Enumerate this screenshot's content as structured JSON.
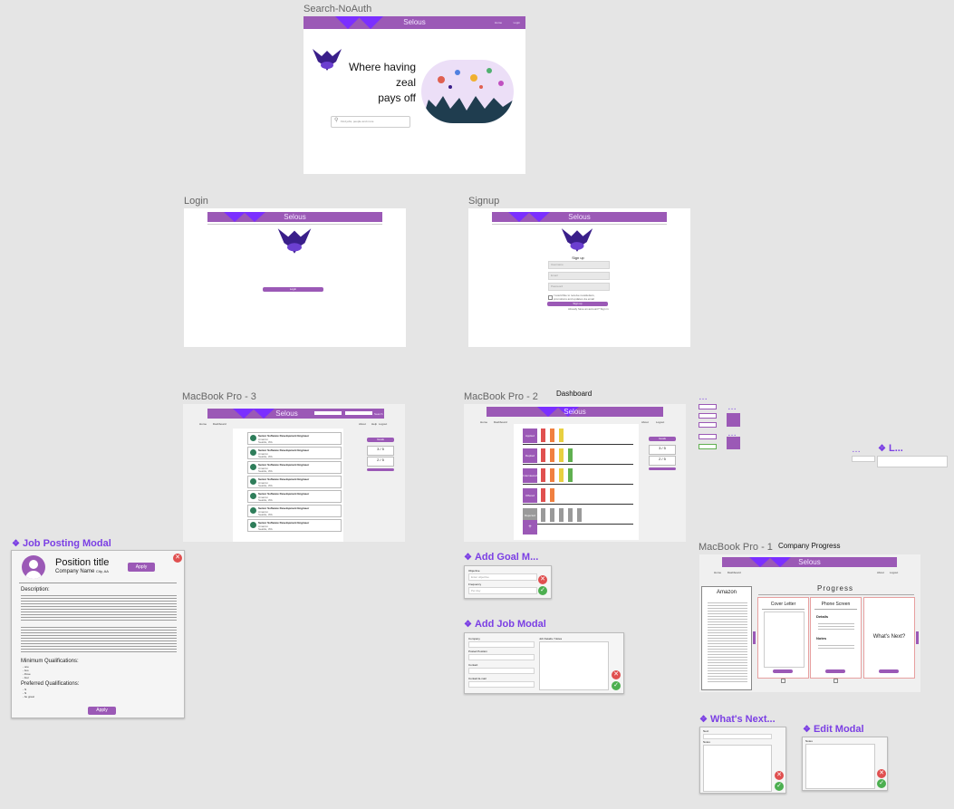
{
  "frames": {
    "search": {
      "label": "Search-NoAuth",
      "brand": "Selous",
      "nav_left": "Home",
      "nav_right": "Login",
      "tagline_1": "Where having",
      "tagline_2": "zeal",
      "tagline_3": "pays off",
      "search_placeholder": "Find jobs, people and more"
    },
    "login": {
      "label": "Login",
      "brand": "Selous",
      "login_button": "Login"
    },
    "signup": {
      "label": "Signup",
      "brand": "Selous",
      "heading": "Sign up",
      "field_1": "Username",
      "field_2": "Email",
      "field_3": "Password",
      "checkbox_text": "I would like to receive newsletters, promotions and updates via email",
      "signup_button": "Sign up",
      "footer_link": "Already have an account? Sign in"
    },
    "mbp3": {
      "label": "MacBook Pro - 3",
      "brand": "Selous",
      "nav_left_1": "Home",
      "nav_left_2": "Dashboard",
      "nav_right_1": "About",
      "nav_right_2": "Help",
      "nav_right_3": "Logout",
      "search_btn": "Search",
      "jobs": [
        {
          "title": "Senior Software Development Engineer",
          "company": "Amazon",
          "location": "Seattle, WA"
        },
        {
          "title": "Senior Software Development Engineer",
          "company": "Amazon",
          "location": "Seattle, WA"
        },
        {
          "title": "Senior Software Development Engineer",
          "company": "Amazon",
          "location": "Seattle, WA"
        },
        {
          "title": "Senior Software Development Engineer",
          "company": "Amazon",
          "location": "Seattle, WA"
        },
        {
          "title": "Senior Software Development Engineer",
          "company": "Amazon",
          "location": "Seattle, WA"
        },
        {
          "title": "Senior Software Development Engineer",
          "company": "Amazon",
          "location": "Seattle, WA"
        },
        {
          "title": "Senior Software Development Engineer",
          "company": "Amazon",
          "location": "Seattle, WA"
        }
      ],
      "goals_title": "Goals",
      "goal_1": "3 / 5",
      "goal_2": "2 / 5"
    },
    "mbp2": {
      "label": "MacBook Pro - 2",
      "annotation": "Dashboard",
      "brand": "Selous",
      "nav_left_1": "Home",
      "nav_left_2": "Dashboard",
      "nav_right_1": "About",
      "nav_right_2": "Logout",
      "rows": [
        {
          "name": "Applied",
          "bars": 3
        },
        {
          "name": "Replied",
          "bars": 4
        },
        {
          "name": "Interviewed",
          "bars": 4
        },
        {
          "name": "Offered",
          "bars": 2
        },
        {
          "name": "Rejected",
          "bars": 5
        }
      ],
      "add_label": "+",
      "goals_title": "Goals",
      "goal_1": "3 / 5",
      "goal_2": "2 / 5"
    },
    "mbp1": {
      "label": "MacBook Pro - 1",
      "annotation": "Company Progress",
      "brand": "Selous",
      "progress_title": "Progress",
      "company": "Amazon",
      "columns": [
        "Cover Letter",
        "Phone Screen",
        "What's Next?"
      ],
      "details_label": "Details",
      "notes_label": "Notes"
    }
  },
  "components": {
    "job_modal": {
      "label": "Job Posting Modal",
      "position_title": "Position title",
      "company_name": "Company Name",
      "location": "City, AA",
      "apply": "Apply",
      "description_label": "Description:",
      "min_qual_label": "Minimum Qualifications:",
      "pref_qual_label": "Preferred Qualifications:",
      "apply_bottom": "Apply",
      "min_quals": [
        "- one",
        "- two",
        "- three",
        "- four"
      ],
      "pref_quals": [
        "- hi",
        "- hi",
        "- be great"
      ]
    },
    "add_goal": {
      "label": "Add Goal M...",
      "field_1_label": "Objective",
      "field_1_placeholder": "Enter objective",
      "field_2_label": "Frequency",
      "field_2_placeholder": "Per day"
    },
    "add_job": {
      "label": "Add Job Modal",
      "company_label": "Company",
      "position_label": "Posted Position",
      "contact_label": "Contact",
      "email_label": "Contact E-mail",
      "details_label": "Job Details / Notes"
    },
    "whats_next": {
      "label": "What's Next...",
      "field_1_label": "Next",
      "field_2_label": "Notes"
    },
    "edit_modal": {
      "label": "Edit Modal",
      "field_label": "Notes"
    },
    "misc_l": {
      "label": "L..."
    }
  },
  "colors": {
    "brand": "#9b59b6",
    "notch": "#7b2fff",
    "eagle": "#3a1f8a",
    "danger": "#e05050",
    "success": "#4caf50",
    "figma_purple": "#7b3fe4"
  }
}
